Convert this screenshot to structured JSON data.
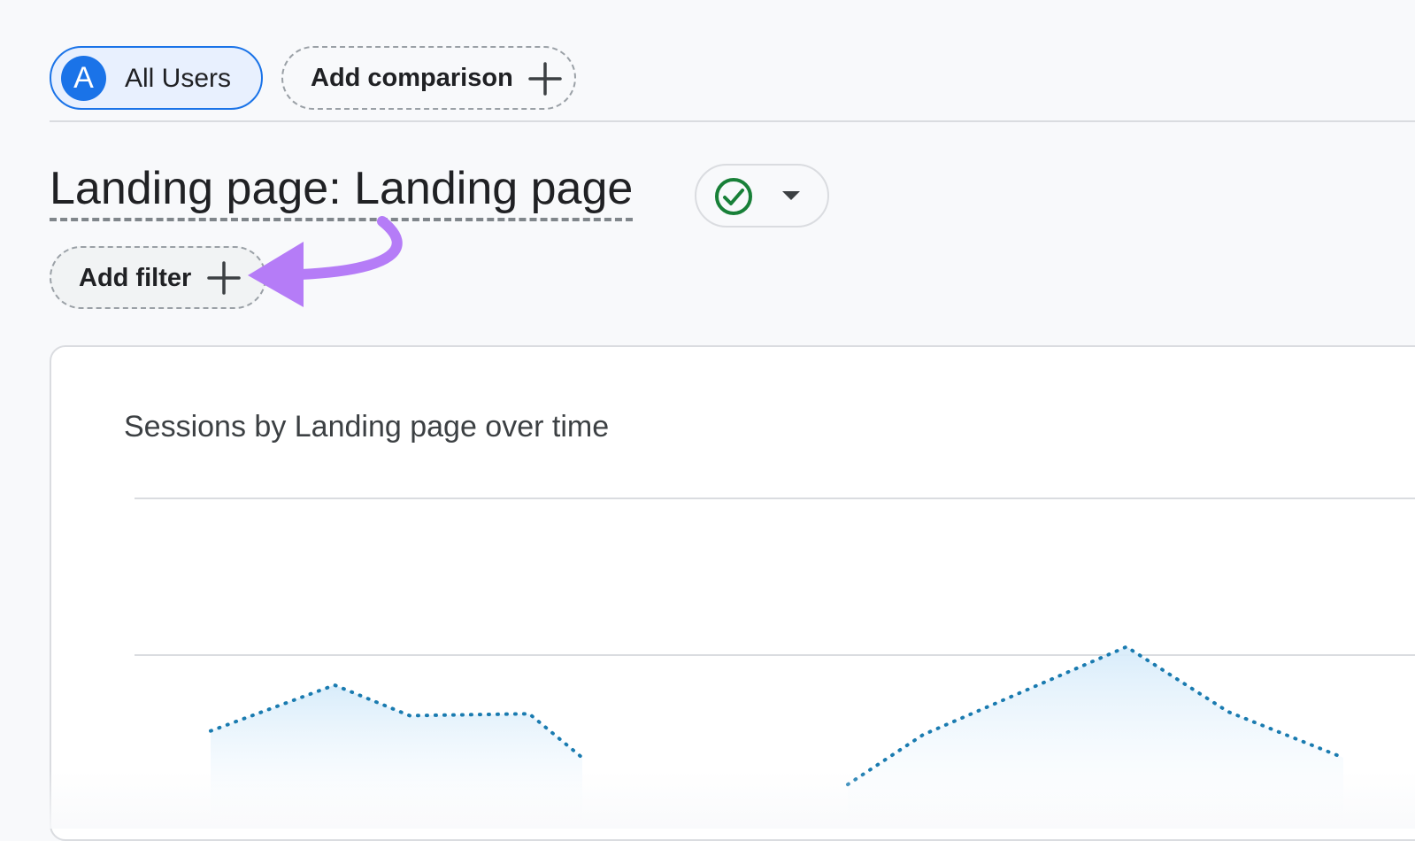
{
  "segments": {
    "all_users": {
      "avatar_letter": "A",
      "label": "All Users"
    },
    "add_comparison": {
      "label": "Add comparison",
      "icon": "plus-icon"
    }
  },
  "report": {
    "title": "Landing page: Landing page",
    "status_icon": "check-circle-icon",
    "dropdown_icon": "caret-down-icon",
    "add_filter": {
      "label": "Add filter",
      "icon": "plus-icon"
    }
  },
  "card": {
    "title": "Sessions by Landing page over time"
  },
  "colors": {
    "accent": "#1a73e8",
    "chip_active_bg": "#e8f0fe",
    "status_green": "#188038",
    "annotation_purple": "#b57cf7",
    "series_line": "#1a7bb0",
    "series_fill": "#e1f0fb"
  },
  "chart_data": {
    "type": "area",
    "title": "Sessions by Landing page over time",
    "series": [
      {
        "values": [
          0.52,
          0.76,
          0.6,
          0.61,
          0.38,
          0.24,
          0.5,
          0.72,
          0.96,
          0.62,
          0.38
        ]
      }
    ],
    "gridlines": 2,
    "grid": true
  }
}
